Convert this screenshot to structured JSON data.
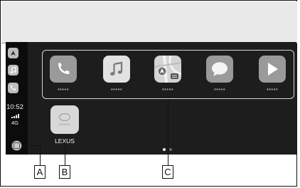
{
  "screen": {
    "sidebar": {
      "recent_apps": [
        {
          "icon": "maps-icon"
        },
        {
          "icon": "music-icon"
        },
        {
          "icon": "phone-icon"
        }
      ],
      "time": "10:52",
      "network": "4G",
      "home_button_icon": "home-button-icon"
    },
    "apps": [
      {
        "icon": "phone-icon",
        "label": "*****"
      },
      {
        "icon": "music-icon",
        "label": "*****"
      },
      {
        "icon": "maps-icon",
        "label": "*****"
      },
      {
        "icon": "messages-icon",
        "label": "*****"
      },
      {
        "icon": "play-icon",
        "label": "*****"
      }
    ],
    "lexus_app": {
      "label": "LEXUS",
      "tile_text": "LEXUS"
    },
    "page_indicator": {
      "pages": 2,
      "current": 1
    }
  },
  "callouts": {
    "a": "A",
    "b": "B",
    "c": "C"
  },
  "colors": {
    "screen": "#1d1d1d",
    "sidebar": "#0c0c0c",
    "bezel": "#e9e9e9",
    "tile": "#9a9a9a"
  }
}
